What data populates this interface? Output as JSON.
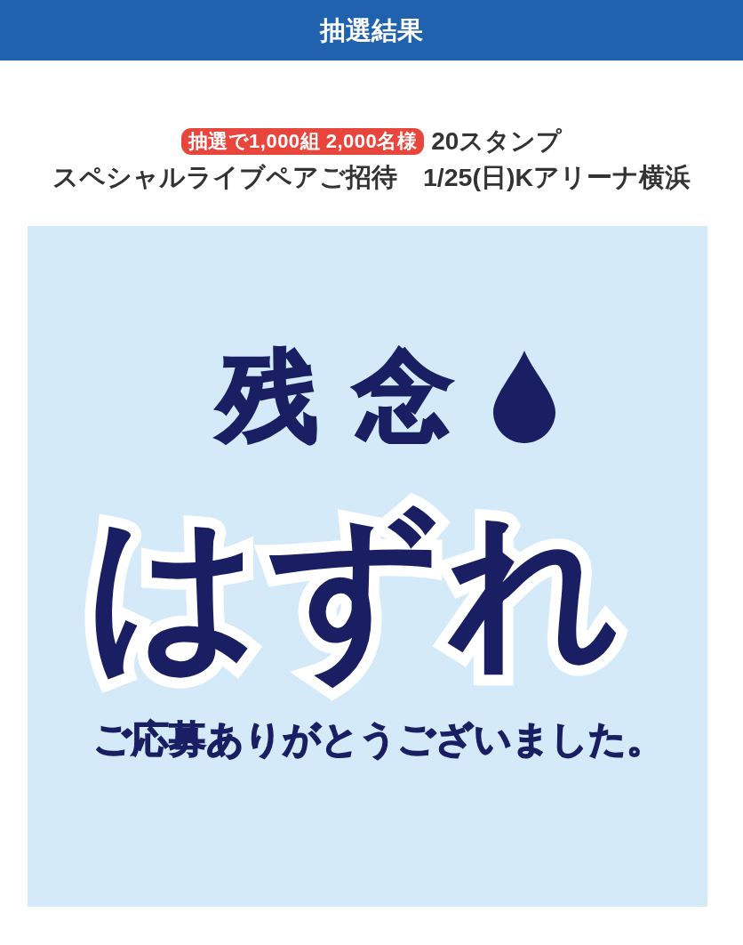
{
  "header": {
    "title": "抽選結果"
  },
  "prize": {
    "badge": "抽選で1,000組 2,000名様",
    "stamps": "20スタンプ",
    "description": "スペシャルライブペアご招待　1/25(日)Kアリーナ横浜"
  },
  "result_image": {
    "heading": "残念",
    "main_text": "はずれ",
    "message": "ご応募ありがとうございました。"
  }
}
